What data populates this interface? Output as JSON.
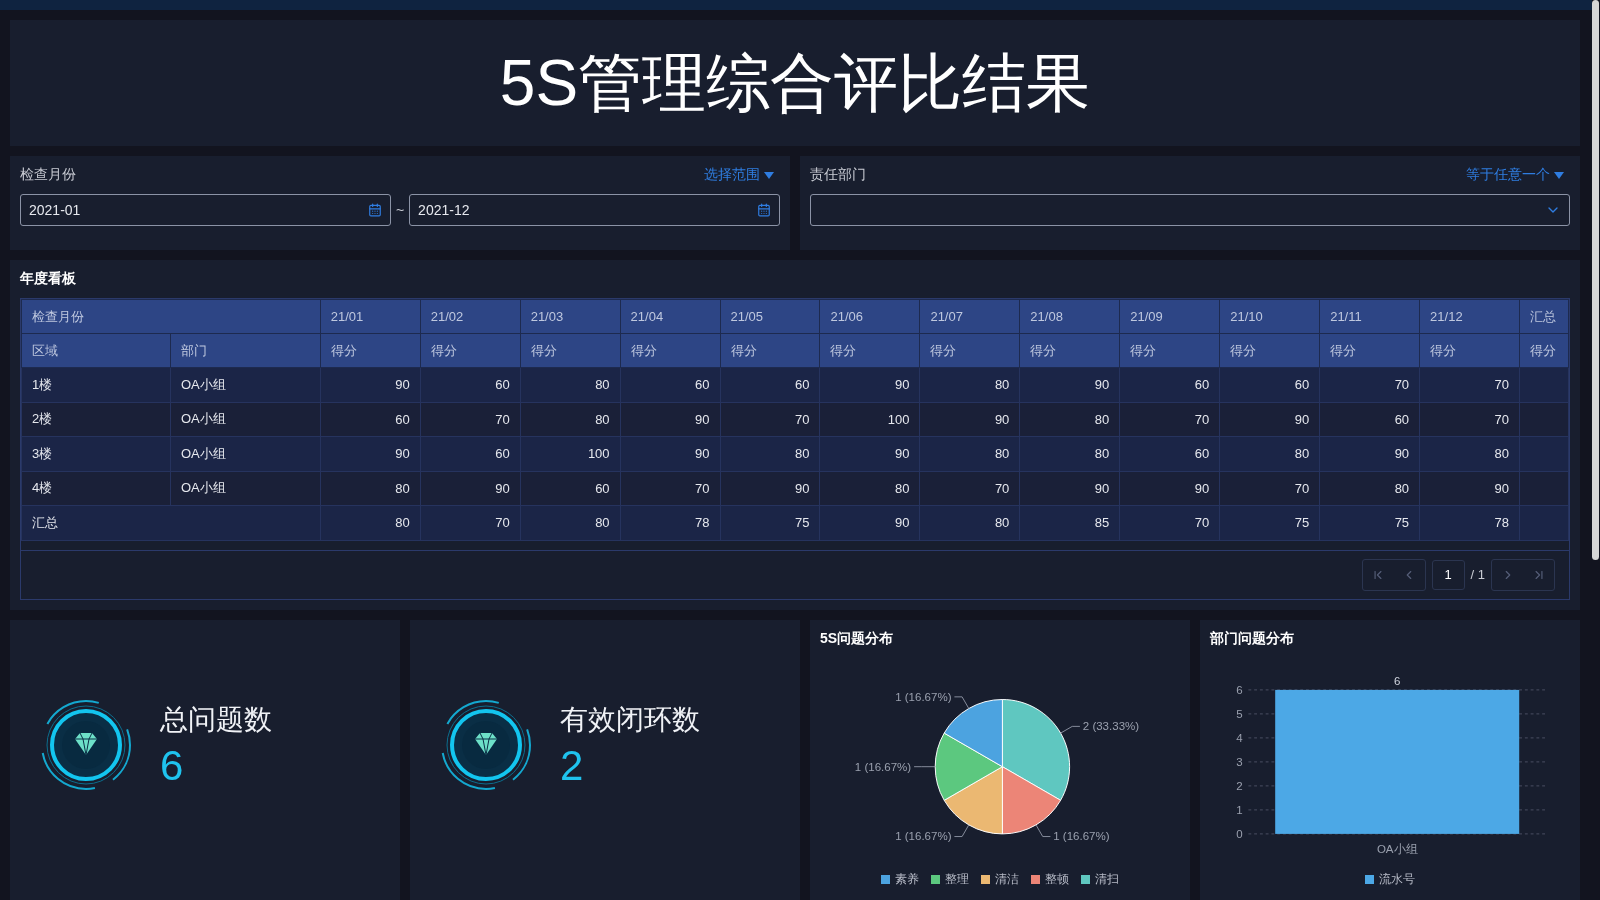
{
  "title": "5S管理综合评比结果",
  "filters": [
    {
      "label": "检查月份",
      "mode": "选择范围",
      "kind": "range",
      "from": "2021-01",
      "separator": "~",
      "to": "2021-12"
    },
    {
      "label": "责任部门",
      "mode": "等于任意一个",
      "kind": "select"
    }
  ],
  "board": {
    "title": "年度看板",
    "group_header": "检查月份",
    "months": [
      "21/01",
      "21/02",
      "21/03",
      "21/04",
      "21/05",
      "21/06",
      "21/07",
      "21/08",
      "21/09",
      "21/10",
      "21/11",
      "21/12"
    ],
    "total_header": "汇总",
    "columns": [
      "区域",
      "部门"
    ],
    "score_headers": [
      "得分",
      "得分",
      "得分",
      "得分",
      "得分",
      "得分",
      "得分",
      "得分",
      "得分",
      "得分",
      "得分",
      "得分",
      "得分"
    ],
    "rows": [
      {
        "area": "1楼",
        "dept": "OA小组",
        "scores": [
          "90",
          "60",
          "80",
          "60",
          "60",
          "90",
          "80",
          "90",
          "60",
          "60",
          "70",
          "70"
        ]
      },
      {
        "area": "2楼",
        "dept": "OA小组",
        "scores": [
          "60",
          "70",
          "80",
          "90",
          "70",
          "100",
          "90",
          "80",
          "70",
          "90",
          "60",
          "70"
        ]
      },
      {
        "area": "3楼",
        "dept": "OA小组",
        "scores": [
          "90",
          "60",
          "100",
          "90",
          "80",
          "90",
          "80",
          "80",
          "60",
          "80",
          "90",
          "80"
        ]
      },
      {
        "area": "4楼",
        "dept": "OA小组",
        "scores": [
          "80",
          "90",
          "60",
          "70",
          "90",
          "80",
          "70",
          "90",
          "90",
          "70",
          "80",
          "90"
        ]
      }
    ],
    "total_row": {
      "label": "汇总",
      "scores": [
        "80",
        "70",
        "80",
        "78",
        "75",
        "90",
        "80",
        "85",
        "70",
        "75",
        "75",
        "78"
      ]
    },
    "pagination": {
      "page": "1",
      "total": "/ 1"
    }
  },
  "stats": [
    {
      "label": "总问题数",
      "value": "6"
    },
    {
      "label": "有效闭环数",
      "value": "2"
    }
  ],
  "pie": {
    "title": "5S问题分布",
    "chart_data": {
      "type": "pie",
      "categories": [
        "素养",
        "整理",
        "清洁",
        "整顿",
        "清扫"
      ],
      "values": [
        1,
        1,
        1,
        1,
        2
      ],
      "value_labels": [
        "1 (16.67%)",
        "1 (16.67%)",
        "1 (16.67%)",
        "1 (16.67%)",
        "2 (33.33%)"
      ],
      "colors": [
        "#4ca3e0",
        "#5cc87f",
        "#ebb872",
        "#ec8577",
        "#5fc7c0"
      ]
    }
  },
  "bar": {
    "title": "部门问题分布",
    "chart_data": {
      "type": "bar",
      "categories": [
        "OA小组"
      ],
      "series": [
        {
          "name": "流水号",
          "color": "#4ca8e6",
          "values": [
            6
          ]
        }
      ],
      "ylim": [
        0,
        6
      ],
      "yticks": [
        0,
        1,
        2,
        3,
        4,
        5,
        6
      ],
      "data_labels": true,
      "grid": true
    }
  }
}
